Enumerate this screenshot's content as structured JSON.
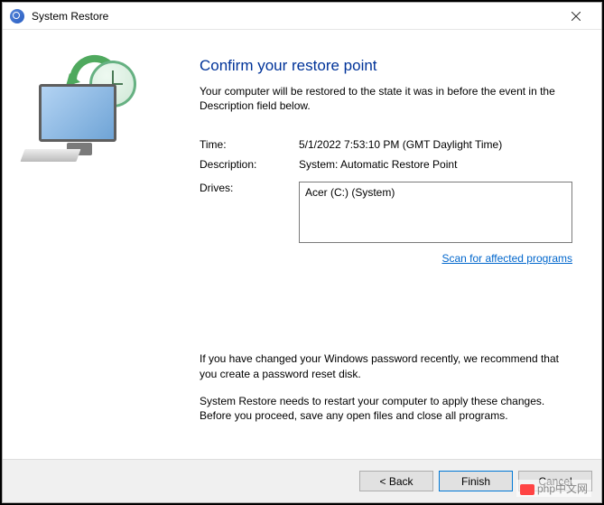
{
  "window": {
    "title": "System Restore"
  },
  "heading": "Confirm your restore point",
  "intro": "Your computer will be restored to the state it was in before the event in the Description field below.",
  "fields": {
    "time_label": "Time:",
    "time_value": "5/1/2022 7:53:10 PM (GMT Daylight Time)",
    "desc_label": "Description:",
    "desc_value": "System: Automatic Restore Point",
    "drives_label": "Drives:",
    "drives_value": "Acer (C:) (System)"
  },
  "scan_link": "Scan for affected programs",
  "note_password": "If you have changed your Windows password recently, we recommend that you create a password reset disk.",
  "note_restart": "System Restore needs to restart your computer to apply these changes. Before you proceed, save any open files and close all programs.",
  "buttons": {
    "back": "< Back",
    "finish": "Finish",
    "cancel": "Cancel"
  },
  "watermark": "php中文网"
}
